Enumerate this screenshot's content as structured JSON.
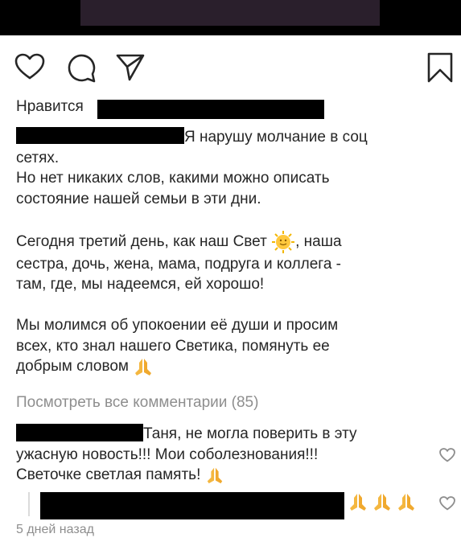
{
  "post": {
    "actions": [
      "like-icon",
      "comment-icon",
      "share-icon",
      "bookmark-icon"
    ],
    "likes_label": "Нравится",
    "caption_lines": {
      "l1": "Я нарушу молчание в соц",
      "l2": "сетях.",
      "l3": "Но нет никаких слов, какими можно описать",
      "l4": "состояние нашей семьи в эти дни.",
      "l5a": "Сегодня третий день, как наш Свет",
      "l5b": ", наша",
      "l6": "сестра, дочь, жена, мама, подруга и коллега -",
      "l7": "там, где, мы надеемся, ей хорошо!",
      "l8": "Мы молимся об упокоении её души и просим",
      "l9": "всех, кто знал нашего Светика, помянуть ее",
      "l10": "добрым словом"
    },
    "view_all_comments": "Посмотреть все комментарии (85)",
    "comment1": {
      "l1": "Таня, не могла поверить в эту",
      "l2": "ужасную новость!!! Мои соболезнования!!!",
      "l3": "Светочке светлая память!"
    },
    "timestamp": "5 дней назад"
  },
  "icons": {
    "sun": "sun-emoji",
    "pray": "praying-hands-emoji"
  },
  "colors": {
    "text": "#262626",
    "muted": "#8e8e8e",
    "redaction": "#000000"
  }
}
